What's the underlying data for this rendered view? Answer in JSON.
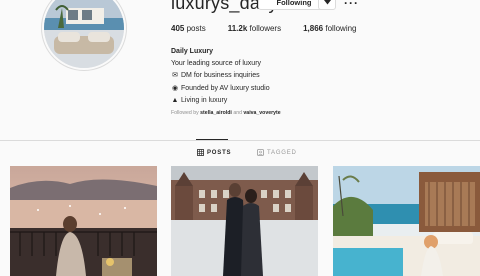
{
  "profile": {
    "username": "luxurys_daily",
    "following_button": "Following",
    "more_label": "···"
  },
  "stats": {
    "posts_count": "405",
    "posts_label": "posts",
    "followers_count": "11.2k",
    "followers_label": "followers",
    "following_count": "1,866",
    "following_label": "following"
  },
  "bio": {
    "name": "Daily Luxury",
    "lines": [
      {
        "icon": "🏷",
        "text": "Your leading source of luxury"
      },
      {
        "icon": "📧",
        "text": "DM for business inquiries"
      },
      {
        "icon": "🌍",
        "text": "Founded by AV luxury studio"
      },
      {
        "icon": "🎩",
        "text": "Living in luxury"
      }
    ]
  },
  "followed_by": {
    "prefix": "Followed by",
    "user1": "stella_airoldi",
    "conjunction": "and",
    "user2": "vaiva_voveryte"
  },
  "tabs": {
    "posts": "POSTS",
    "tagged": "TAGGED"
  },
  "icons": {
    "posts_tab": "grid-icon",
    "tagged_tab": "tag-icon",
    "dropdown": "chevron-down-icon"
  }
}
